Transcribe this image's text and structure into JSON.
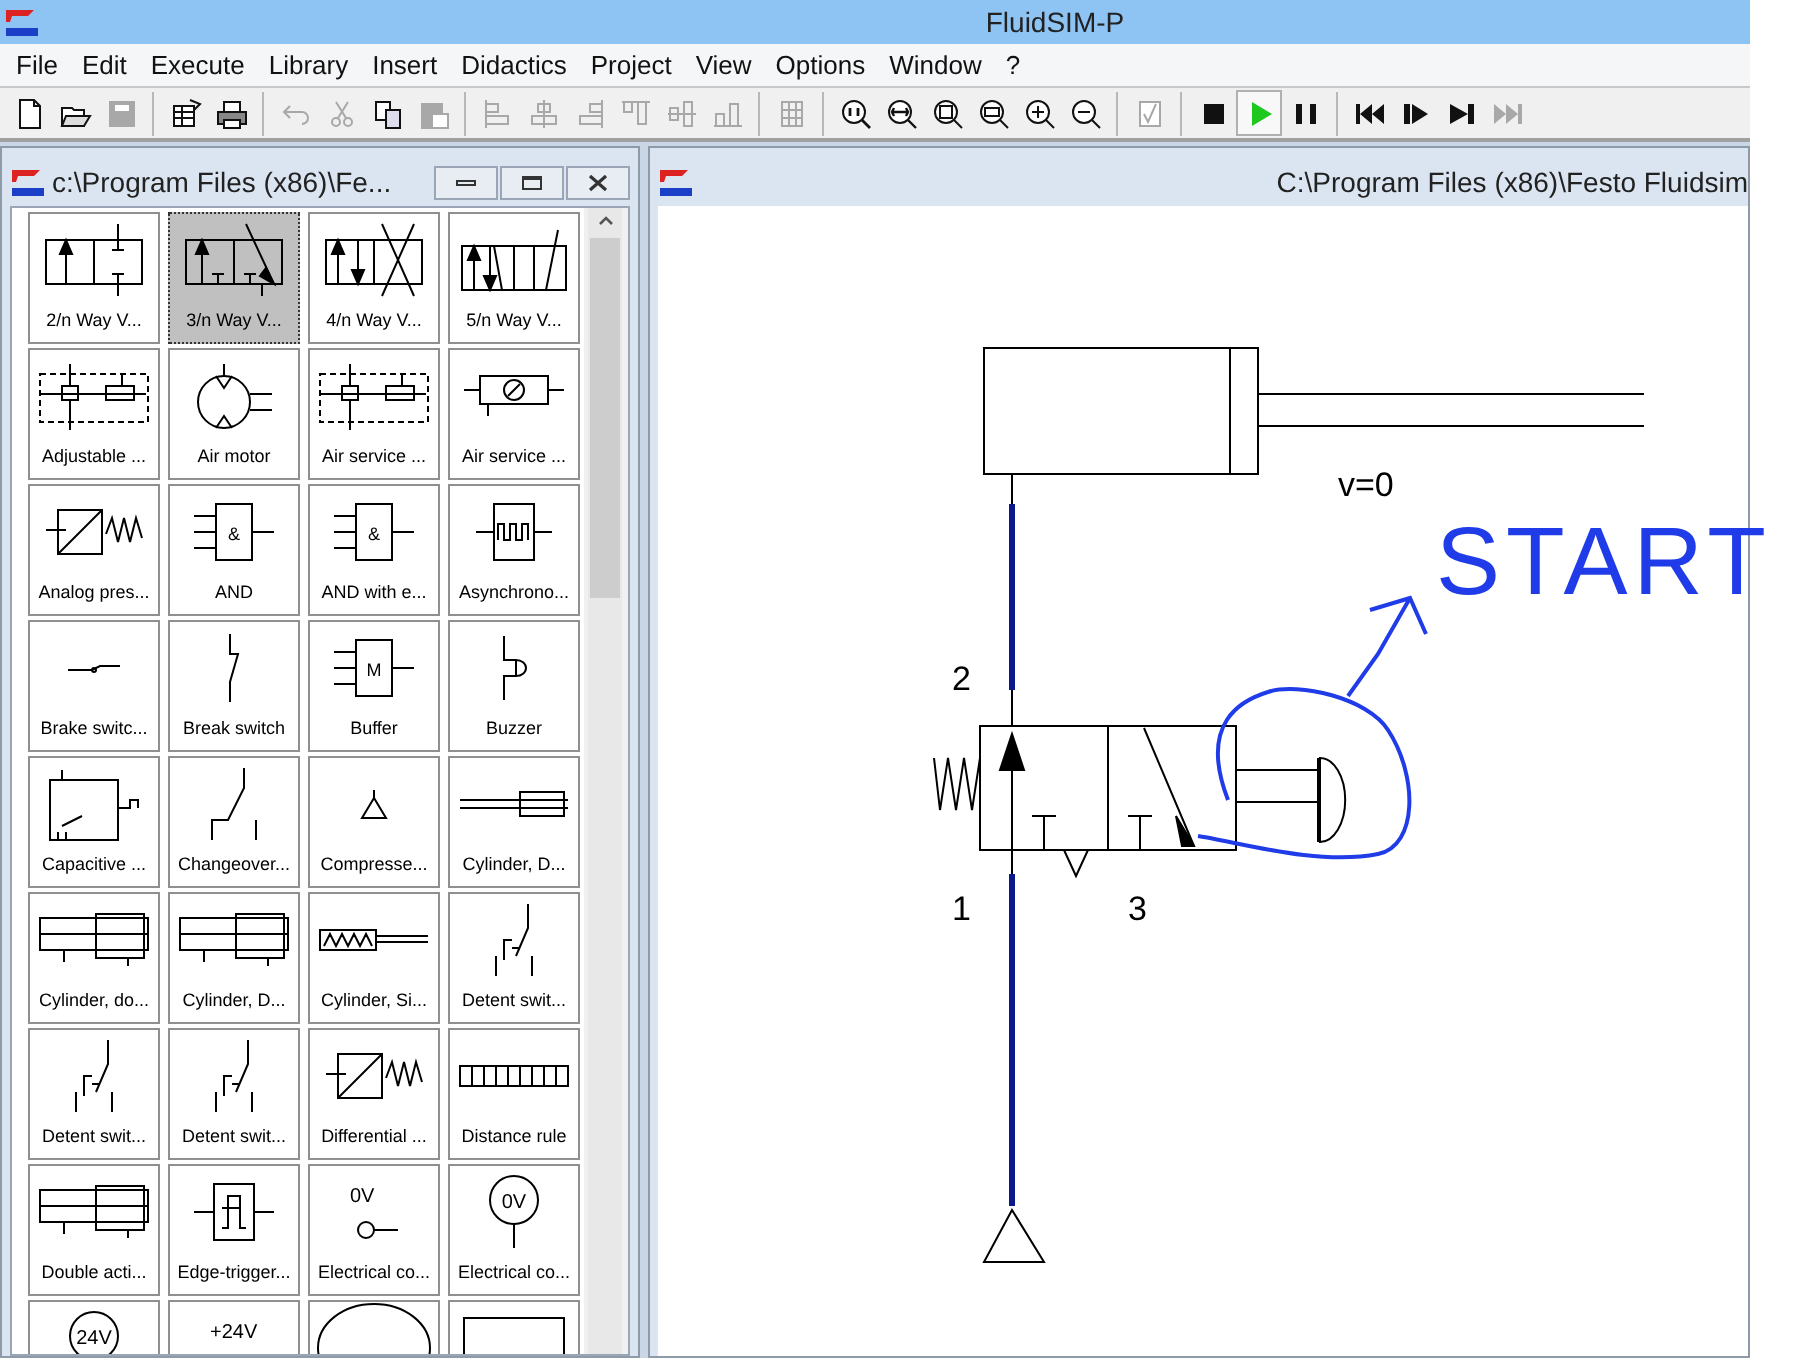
{
  "window": {
    "title": "FluidSIM-P"
  },
  "menu": [
    "File",
    "Edit",
    "Execute",
    "Library",
    "Insert",
    "Didactics",
    "Project",
    "View",
    "Options",
    "Window",
    "?"
  ],
  "toolbar": [
    {
      "kind": "new",
      "disabled": false
    },
    {
      "kind": "open",
      "disabled": false
    },
    {
      "kind": "save",
      "disabled": true
    },
    {
      "kind": "sep"
    },
    {
      "kind": "open-library",
      "disabled": false
    },
    {
      "kind": "print",
      "disabled": false
    },
    {
      "kind": "sep"
    },
    {
      "kind": "undo",
      "disabled": true
    },
    {
      "kind": "cut",
      "disabled": true
    },
    {
      "kind": "copy",
      "disabled": false
    },
    {
      "kind": "paste",
      "disabled": true
    },
    {
      "kind": "sep"
    },
    {
      "kind": "align-left",
      "disabled": true
    },
    {
      "kind": "align-center",
      "disabled": true
    },
    {
      "kind": "align-right",
      "disabled": true
    },
    {
      "kind": "align-top",
      "disabled": true
    },
    {
      "kind": "align-middle",
      "disabled": true
    },
    {
      "kind": "align-bottom",
      "disabled": true
    },
    {
      "kind": "sep"
    },
    {
      "kind": "grid",
      "disabled": true
    },
    {
      "kind": "sep"
    },
    {
      "kind": "zoom-actual",
      "disabled": false
    },
    {
      "kind": "zoom-width",
      "disabled": false
    },
    {
      "kind": "zoom-fit",
      "disabled": false
    },
    {
      "kind": "zoom-window",
      "disabled": false
    },
    {
      "kind": "zoom-in",
      "disabled": false
    },
    {
      "kind": "zoom-out",
      "disabled": false
    },
    {
      "kind": "sep"
    },
    {
      "kind": "check",
      "disabled": true
    },
    {
      "kind": "sep"
    },
    {
      "kind": "stop",
      "disabled": false,
      "selected": false
    },
    {
      "kind": "play",
      "disabled": false,
      "selected": true
    },
    {
      "kind": "pause",
      "disabled": false,
      "selected": false
    },
    {
      "kind": "sep"
    },
    {
      "kind": "reset",
      "disabled": false
    },
    {
      "kind": "step",
      "disabled": false
    },
    {
      "kind": "step-end",
      "disabled": false
    },
    {
      "kind": "fast-forward",
      "disabled": true
    }
  ],
  "library_window": {
    "title": "c:\\Program Files (x86)\\Fe...",
    "tiles": [
      {
        "label": "2/n Way V...",
        "kind": "valve2",
        "selected": false
      },
      {
        "label": "3/n Way V...",
        "kind": "valve3",
        "selected": true
      },
      {
        "label": "4/n Way V...",
        "kind": "valve4",
        "selected": false
      },
      {
        "label": "5/n Way V...",
        "kind": "valve5",
        "selected": false
      },
      {
        "label": "Adjustable ...",
        "kind": "service",
        "selected": false
      },
      {
        "label": "Air motor",
        "kind": "motor",
        "selected": false
      },
      {
        "label": "Air service ...",
        "kind": "service",
        "selected": false
      },
      {
        "label": "Air service ...",
        "kind": "gauge",
        "selected": false
      },
      {
        "label": "Analog pres...",
        "kind": "press",
        "selected": false
      },
      {
        "label": "AND",
        "kind": "logic",
        "symbol_text": "&",
        "selected": false
      },
      {
        "label": "AND with e...",
        "kind": "logic",
        "symbol_text": "&",
        "selected": false
      },
      {
        "label": "Asynchrono...",
        "kind": "timer",
        "selected": false
      },
      {
        "label": "Brake switc...",
        "kind": "brake",
        "selected": false
      },
      {
        "label": "Break switch",
        "kind": "breaker",
        "selected": false
      },
      {
        "label": "Buffer",
        "kind": "logic",
        "symbol_text": "M",
        "selected": false
      },
      {
        "label": "Buzzer",
        "kind": "buzzer",
        "selected": false
      },
      {
        "label": "Capacitive ...",
        "kind": "sensor",
        "selected": false
      },
      {
        "label": "Changeover...",
        "kind": "changeover",
        "selected": false
      },
      {
        "label": "Compresse...",
        "kind": "compressor",
        "selected": false
      },
      {
        "label": "Cylinder, D...",
        "kind": "rod",
        "selected": false
      },
      {
        "label": "Cylinder, do...",
        "kind": "cylinder",
        "selected": false
      },
      {
        "label": "Cylinder, D...",
        "kind": "cylinder",
        "selected": false
      },
      {
        "label": "Cylinder, Si...",
        "kind": "spring-cylinder",
        "selected": false
      },
      {
        "label": "Detent swit...",
        "kind": "detent",
        "selected": false
      },
      {
        "label": "Detent swit...",
        "kind": "detent",
        "selected": false
      },
      {
        "label": "Detent swit...",
        "kind": "detent",
        "selected": false
      },
      {
        "label": "Differential ...",
        "kind": "press",
        "selected": false
      },
      {
        "label": "Distance rule",
        "kind": "ruler",
        "selected": false
      },
      {
        "label": "Double acti...",
        "kind": "cylinder",
        "selected": false
      },
      {
        "label": "Edge-trigger...",
        "kind": "edge",
        "selected": false
      },
      {
        "label": "Electrical co...",
        "kind": "supply",
        "symbol_text": "0V",
        "selected": false
      },
      {
        "label": "Electrical co...",
        "kind": "supply-circle",
        "symbol_text": "0V",
        "selected": false
      },
      {
        "kind": "supply-circle",
        "symbol_text": "24V",
        "selected": false
      },
      {
        "kind": "supply",
        "symbol_text": "+24V",
        "selected": false
      },
      {
        "kind": "ellipse",
        "selected": false
      },
      {
        "kind": "board",
        "selected": false
      }
    ]
  },
  "circuit_window": {
    "title": "C:\\Program Files (x86)\\Festo Fluidsim",
    "port_labels": [
      "2",
      "1",
      "3"
    ],
    "velocity_label": "v=0",
    "annotation": "START"
  }
}
